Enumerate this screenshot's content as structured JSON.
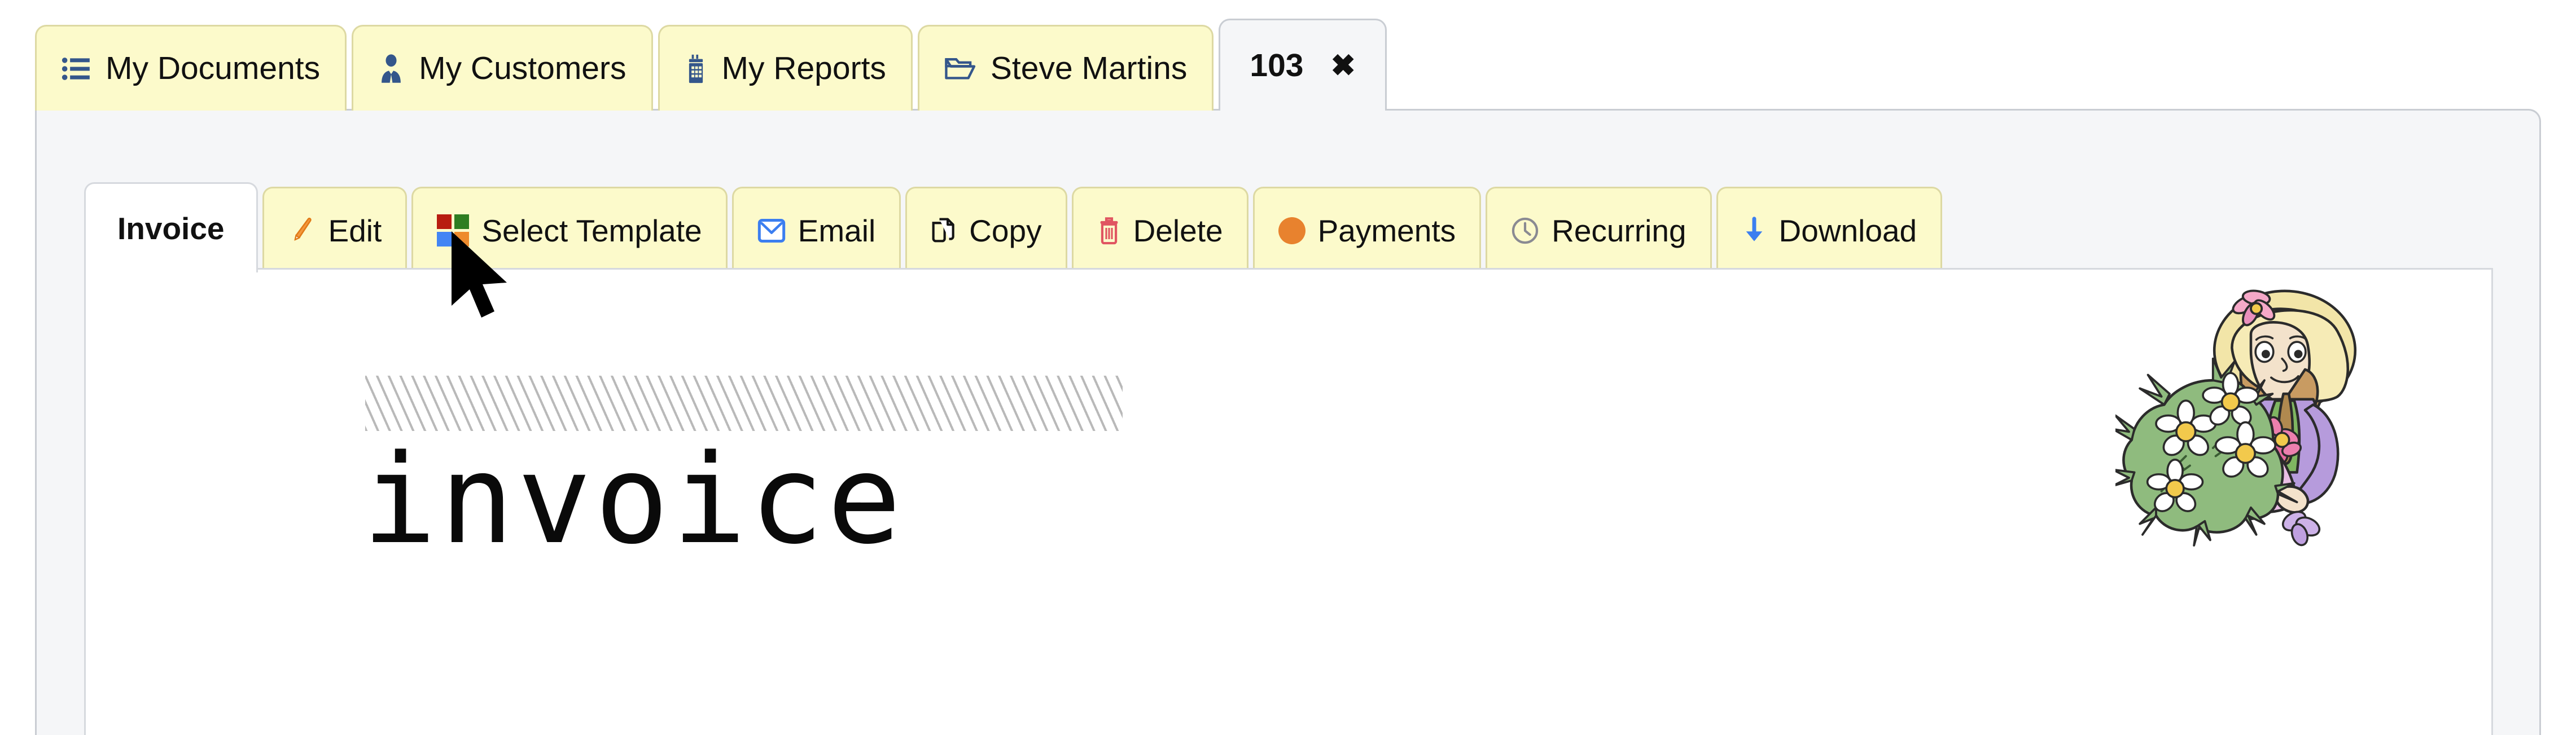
{
  "app": {
    "accent_yellow": "#FCFACB",
    "accent_yellow_border": "#DDD9A3",
    "panel_gray": "#F5F6F8",
    "panel_border": "#C9CDD3"
  },
  "tabstrip": {
    "tabs": [
      {
        "label": "My Documents",
        "icon": "list-icon",
        "icon_color": "#34568B",
        "active": false
      },
      {
        "label": "My Customers",
        "icon": "user-tie-icon",
        "icon_color": "#34568B",
        "active": false
      },
      {
        "label": "My Reports",
        "icon": "report-icon",
        "icon_color": "#34568B",
        "active": false
      },
      {
        "label": "Steve Martins",
        "icon": "open-folder-icon",
        "icon_color": "#34568B",
        "active": false
      }
    ],
    "document_tab": {
      "label": "103",
      "close_label": "✖",
      "close_icon": "close-icon",
      "active": true
    }
  },
  "toolbar": {
    "buttons": [
      {
        "label": "Invoice",
        "icon": null,
        "icon_color": null,
        "active": true
      },
      {
        "label": "Edit",
        "icon": "pencil-icon",
        "icon_color": "#F08D2E",
        "active": false
      },
      {
        "label": "Select Template",
        "icon": "color-swatches-icon",
        "icon_color": "#B81C10",
        "active": false
      },
      {
        "label": "Email",
        "icon": "envelope-icon",
        "icon_color": "#3B7EF0",
        "active": false
      },
      {
        "label": "Copy",
        "icon": "copy-icon",
        "icon_color": "#1A1A1A",
        "active": false
      },
      {
        "label": "Delete",
        "icon": "trash-icon",
        "icon_color": "#E05561",
        "active": false
      },
      {
        "label": "Payments",
        "icon": "orange-dot-icon",
        "icon_color": "#E8822E",
        "active": false
      },
      {
        "label": "Recurring",
        "icon": "clock-icon",
        "icon_color": "#8A8A92",
        "active": false
      },
      {
        "label": "Download",
        "icon": "download-arrow-icon",
        "icon_color": "#3B7EF0",
        "active": false
      }
    ],
    "swatch_colors": [
      "#B81C10",
      "#2E7D22",
      "#4285F4",
      "#EE8B2D"
    ]
  },
  "sheet": {
    "heading": "invoice",
    "hatch_color": "#B9B9B9",
    "illustration": "girl-with-daisy-bouquet-illustration"
  },
  "cursor": {
    "icon": "mouse-pointer-icon",
    "color": "#000000"
  }
}
